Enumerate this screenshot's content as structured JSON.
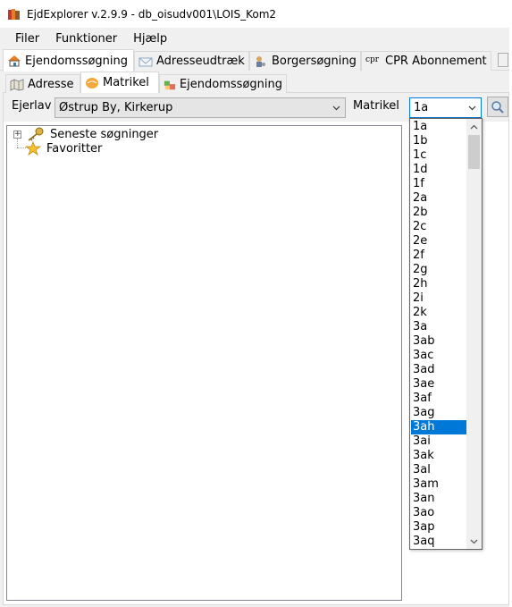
{
  "window": {
    "title": "EjdExplorer v.2.9.9 - db_oisudv001\\LOIS_Kom2",
    "app_icon": "books-icon"
  },
  "menu": {
    "items": [
      "Filer",
      "Funktioner",
      "Hjælp"
    ]
  },
  "main_tabs": [
    {
      "label": "Ejendomssøgning",
      "icon": "house-icon",
      "active": true
    },
    {
      "label": "Adresseudtræk",
      "icon": "envelope-icon",
      "active": false
    },
    {
      "label": "Borgersøgning",
      "icon": "person-icon",
      "active": false
    },
    {
      "label": "CPR Abonnement",
      "icon": "cpr-icon",
      "icon_text": "cpr",
      "active": false
    }
  ],
  "tab_overflow_icon": "tab-scroll-icon",
  "sub_tabs": [
    {
      "label": "Adresse",
      "icon": "map-icon",
      "active": false
    },
    {
      "label": "Matrikel",
      "icon": "parcel-icon",
      "active": true
    },
    {
      "label": "Ejendomssøgning",
      "icon": "property-icon",
      "active": false
    }
  ],
  "search": {
    "ejerlav_label": "Ejerlav",
    "ejerlav_value": "Østrup By, Kirkerup",
    "matrikel_label": "Matrikel",
    "matrikel_value": "1a",
    "search_icon": "magnifier-icon"
  },
  "tree": {
    "nodes": [
      {
        "label": "Seneste søgninger",
        "icon": "key-icon",
        "expandable": true
      },
      {
        "label": "Favoritter",
        "icon": "star-icon",
        "expandable": false
      }
    ]
  },
  "dropdown": {
    "options": [
      "1a",
      "1b",
      "1c",
      "1d",
      "1f",
      "2a",
      "2b",
      "2c",
      "2e",
      "2f",
      "2g",
      "2h",
      "2i",
      "2k",
      "3a",
      "3ab",
      "3ac",
      "3ad",
      "3ae",
      "3af",
      "3ag",
      "3ah",
      "3ai",
      "3ak",
      "3al",
      "3am",
      "3an",
      "3ao",
      "3ap",
      "3aq"
    ],
    "selected": "3ah"
  },
  "colors": {
    "selection": "#0078d7",
    "focus_border": "#0078d7"
  }
}
